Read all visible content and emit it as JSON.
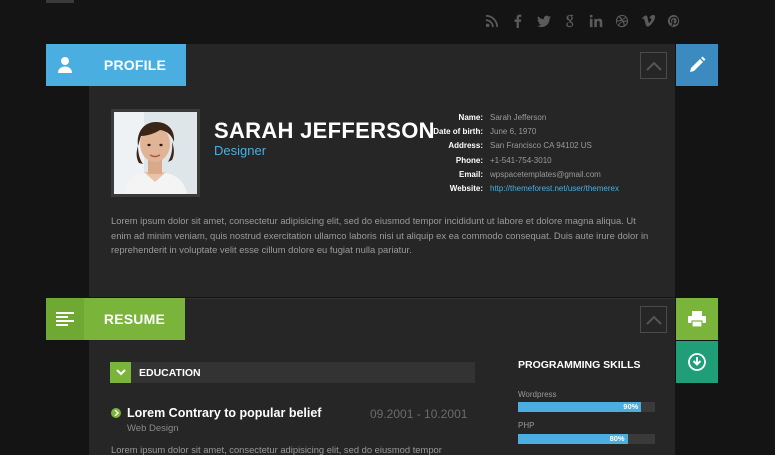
{
  "social": [
    "rss-icon",
    "facebook-icon",
    "twitter-icon",
    "googleplus-icon",
    "linkedin-icon",
    "dribbble-icon",
    "vimeo-icon",
    "pinterest-icon"
  ],
  "colors": {
    "blue": "#4baee0",
    "green": "#7ab43b",
    "teal": "#1f9e77",
    "panel": "#262626",
    "background": "#141414"
  },
  "profile": {
    "tab_label": "PROFILE",
    "name": "SARAH JEFFERSON",
    "role": "Designer",
    "info": [
      {
        "k": "Name:",
        "v": "Sarah Jefferson"
      },
      {
        "k": "Date of birth:",
        "v": "June 6, 1970"
      },
      {
        "k": "Address:",
        "v": "San Francisco CA 94102 US"
      },
      {
        "k": "Phone:",
        "v": "+1-541-754-3010"
      },
      {
        "k": "Email:",
        "v": "wpspacetemplates@gmail.com"
      },
      {
        "k": "Website:",
        "v": "http://themeforest.net/user/themerex"
      }
    ],
    "bio": "Lorem ipsum dolor sit amet, consectetur adipisicing elit, sed do eiusmod tempor incididunt ut labore et dolore magna aliqua. Ut enim ad minim veniam, quis nostrud exercitation ullamco laboris nisi ut aliquip ex ea commodo consequat. Duis aute irure dolor in reprehenderit in voluptate velit esse cillum dolore eu fugiat nulla pariatur."
  },
  "resume": {
    "tab_label": "RESUME",
    "education": {
      "header": "EDUCATION",
      "item": {
        "title": "Lorem Contrary to popular belief",
        "date": "09.2001 - 10.2001",
        "subtitle": "Web Design",
        "desc": "Lorem ipsum dolor sit amet, consectetur adipisicing elit, sed do eiusmod tempor"
      }
    },
    "skills": {
      "header": "PROGRAMMING SKILLS",
      "items": [
        {
          "label": "Wordpress",
          "value": 90,
          "display": "90%"
        },
        {
          "label": "PHP",
          "value": 80,
          "display": "80%"
        }
      ]
    }
  }
}
